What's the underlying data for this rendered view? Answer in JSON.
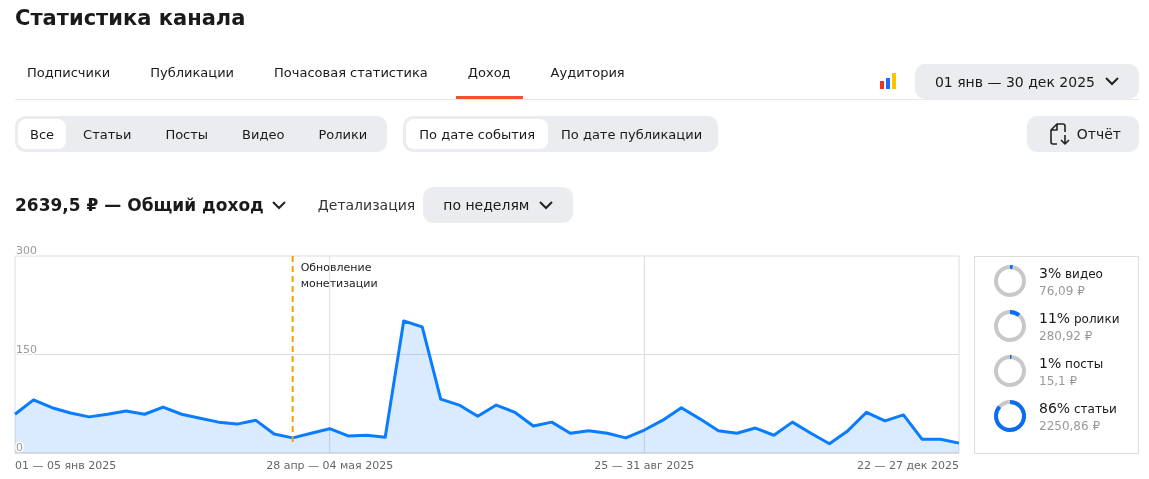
{
  "title": "Статистика канала",
  "tabs": [
    {
      "label": "Подписчики",
      "selected": false
    },
    {
      "label": "Публикации",
      "selected": false
    },
    {
      "label": "Почасовая статистика",
      "selected": false
    },
    {
      "label": "Доход",
      "selected": true
    },
    {
      "label": "Аудитория",
      "selected": false
    }
  ],
  "date_range": "01 янв — 30 дек 2025",
  "content_filter": [
    {
      "label": "Все",
      "selected": true
    },
    {
      "label": "Статьи",
      "selected": false
    },
    {
      "label": "Посты",
      "selected": false
    },
    {
      "label": "Видео",
      "selected": false
    },
    {
      "label": "Ролики",
      "selected": false
    }
  ],
  "date_filter": [
    {
      "label": "По дате события",
      "selected": true
    },
    {
      "label": "По дате публикации",
      "selected": false
    }
  ],
  "report_button": "Отчёт",
  "total": "2639,5 ₽ — Общий доход",
  "detail_label": "Детализация",
  "detail_value": "по неделям",
  "chart_data": {
    "type": "area",
    "ylim": [
      0,
      300
    ],
    "yticks": [
      0,
      150,
      300
    ],
    "grid": true,
    "series": [
      {
        "color": "#0a7cff",
        "values": [
          59,
          81,
          69,
          61,
          55,
          59,
          64,
          59,
          70,
          59,
          53,
          47,
          44,
          50,
          29,
          23,
          30,
          37,
          26,
          27,
          24,
          201,
          192,
          82,
          73,
          56,
          73,
          62,
          41,
          47,
          30,
          34,
          30,
          23,
          35,
          50,
          69,
          52,
          34,
          30,
          38,
          27,
          47,
          30,
          14,
          34,
          62,
          49,
          58,
          21,
          21,
          15
        ]
      }
    ],
    "annotations": [
      "Обновление монетизации"
    ]
  },
  "date_axis_labels": [
    "01 — 05 янв 2025",
    "28 апр — 04 мая 2025",
    "25 — 31 авг 2025",
    "22 — 27 дек 2025"
  ],
  "breakdown": [
    {
      "percent": "3%",
      "label": "видео",
      "amount": "76,09 ₽"
    },
    {
      "percent": "11%",
      "label": "ролики",
      "amount": "280,92 ₽"
    },
    {
      "percent": "1%",
      "label": "посты",
      "amount": "15,1 ₽"
    },
    {
      "percent": "86%",
      "label": "статьи",
      "amount": "2250,86 ₽"
    }
  ]
}
